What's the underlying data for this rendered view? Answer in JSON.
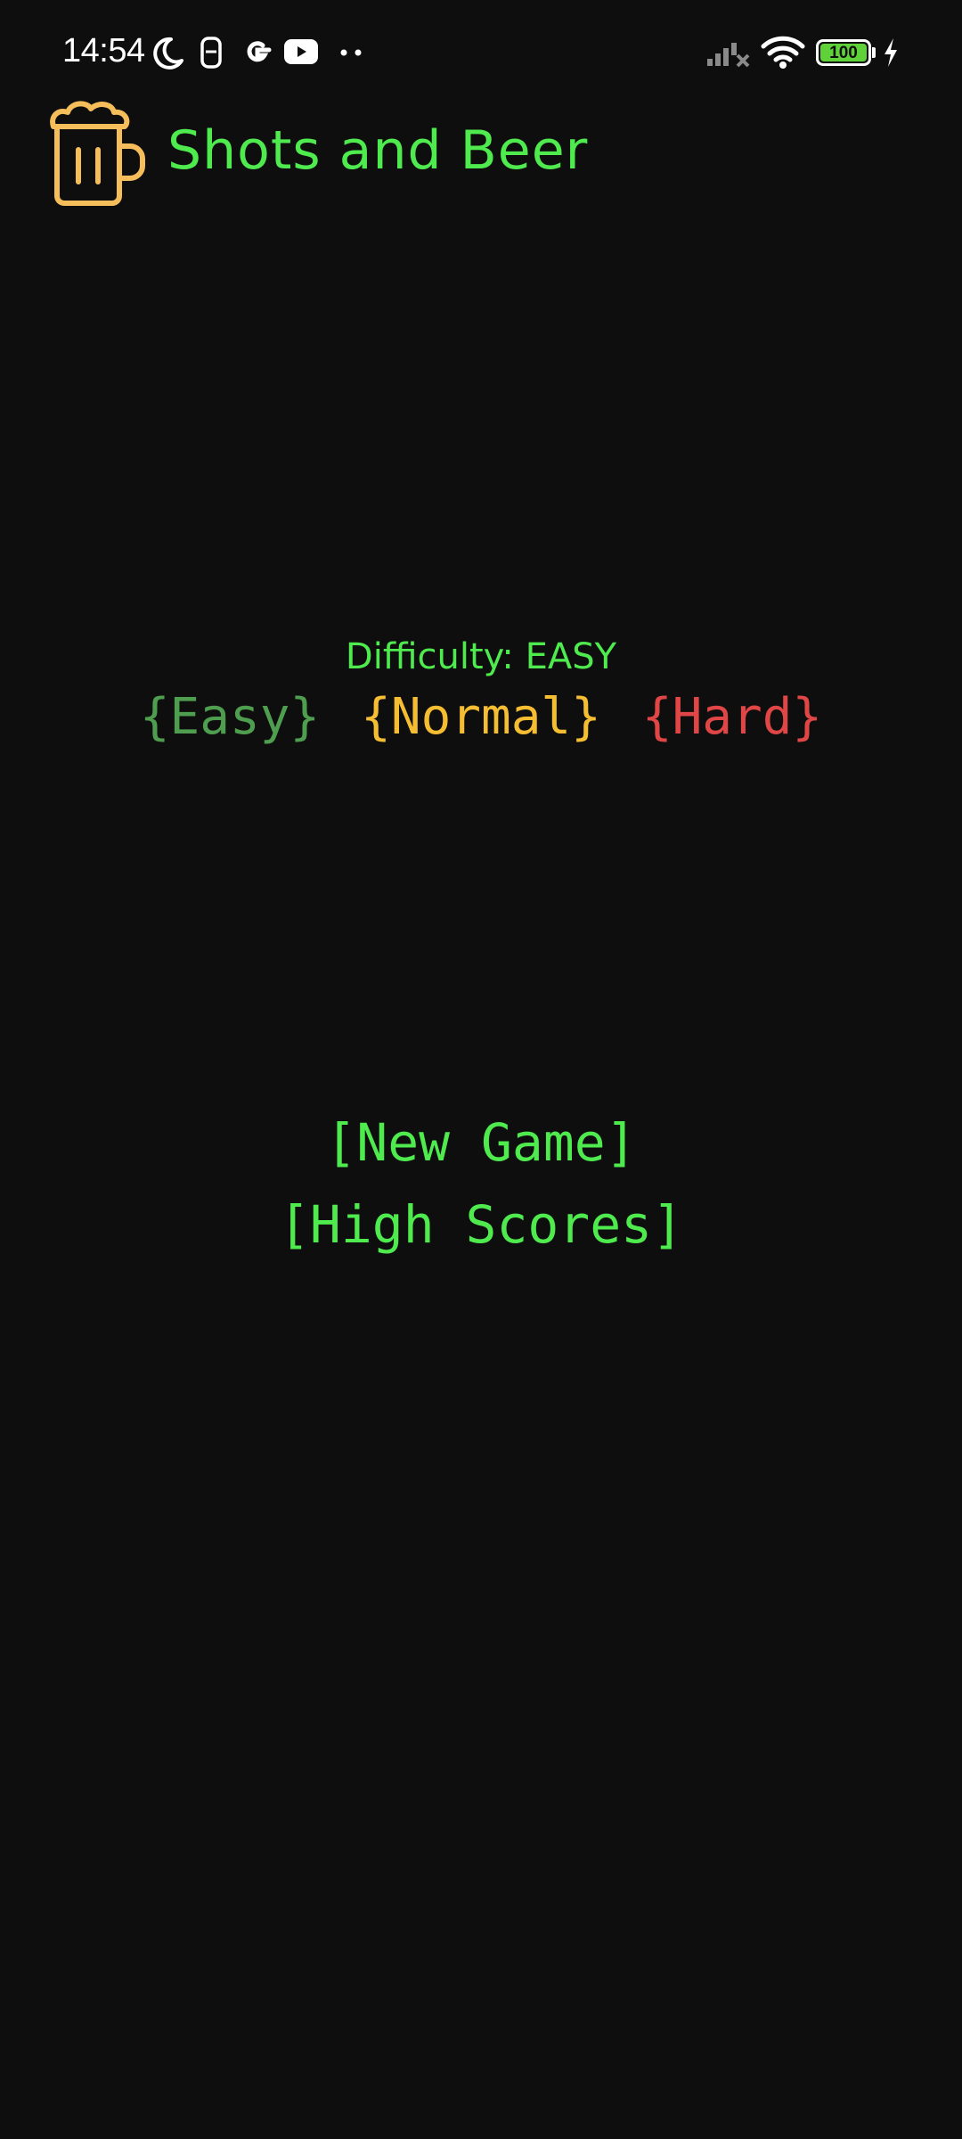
{
  "status_bar": {
    "time": "14:54",
    "battery": "100",
    "icons": [
      "moon-icon",
      "sim-icon",
      "google-icon",
      "youtube-icon",
      "more-dots-icon",
      "signal-icon",
      "wifi-icon",
      "battery-icon",
      "charging-icon"
    ]
  },
  "app_bar": {
    "title": "Shots and Beer",
    "logo": "beer-mug-icon"
  },
  "difficulty": {
    "label": "Difficulty: EASY",
    "options": [
      {
        "label": "{Easy}",
        "color": "#4f9e4f"
      },
      {
        "label": "{Normal}",
        "color": "#f5be32"
      },
      {
        "label": "{Hard}",
        "color": "#e04646"
      }
    ]
  },
  "menu": {
    "new_game": "[New Game]",
    "high_scores": "[High Scores]"
  },
  "colors": {
    "background": "#0e0e0e",
    "accent_green": "#4eea4e",
    "logo_orange": "#f5be5a"
  }
}
